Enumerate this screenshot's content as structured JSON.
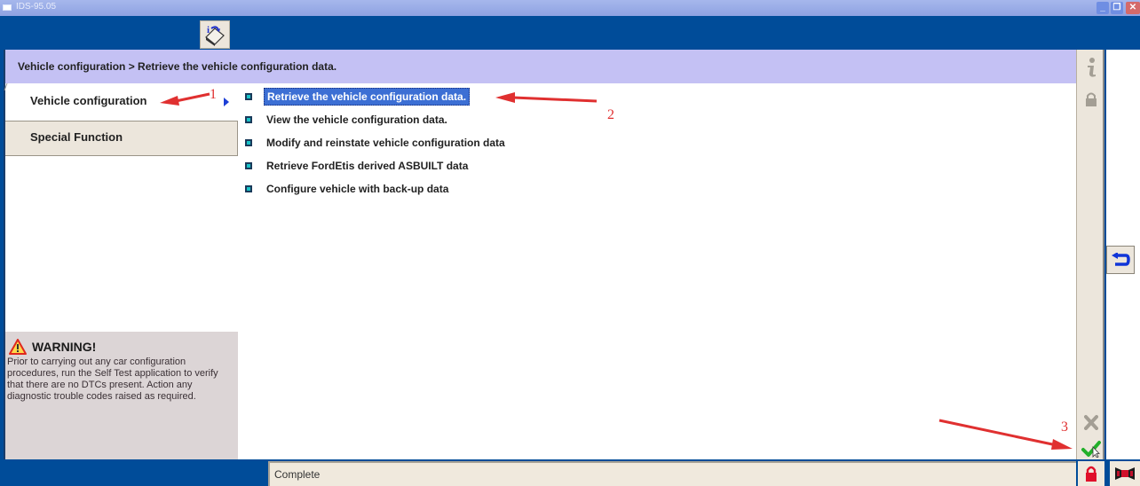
{
  "window": {
    "title": "IDS-95.05",
    "controls": [
      "minimize",
      "restore",
      "close"
    ]
  },
  "toolbar": {
    "info_tool_icon": "info-book-icon"
  },
  "breadcrumb": "Vehicle configuration > Retrieve the vehicle configuration data.",
  "tabs": [
    {
      "label": "Vehicle configuration",
      "active": true
    },
    {
      "label": "Special Function",
      "active": false
    }
  ],
  "menu": {
    "items": [
      {
        "label": "Retrieve the vehicle configuration data.",
        "selected": true
      },
      {
        "label": "View the vehicle configuration data.",
        "selected": false
      },
      {
        "label": "Modify and reinstate vehicle configuration data",
        "selected": false
      },
      {
        "label": "Retrieve FordEtis derived ASBUILT data",
        "selected": false
      },
      {
        "label": "Configure vehicle with back-up data",
        "selected": false
      }
    ]
  },
  "warning": {
    "title": "WARNING!",
    "body": "Prior to carrying out any car configuration procedures, run the Self Test application to verify that there are no DTCs present. Action any diagnostic trouble codes raised as required."
  },
  "sidebar": {
    "icons": [
      "info-icon",
      "lock-icon",
      "cancel-icon",
      "tick-icon"
    ]
  },
  "status": {
    "text": "Complete"
  },
  "annotations": {
    "labels": [
      "1",
      "2",
      "3"
    ],
    "color": "#e03030"
  },
  "colors": {
    "frame": "#004c99",
    "breadcrumb_bg": "#c4c1f4",
    "selection": "#3c6fd4",
    "panel_bg": "#ece6dc",
    "warning_bg": "#dcd5d6"
  }
}
